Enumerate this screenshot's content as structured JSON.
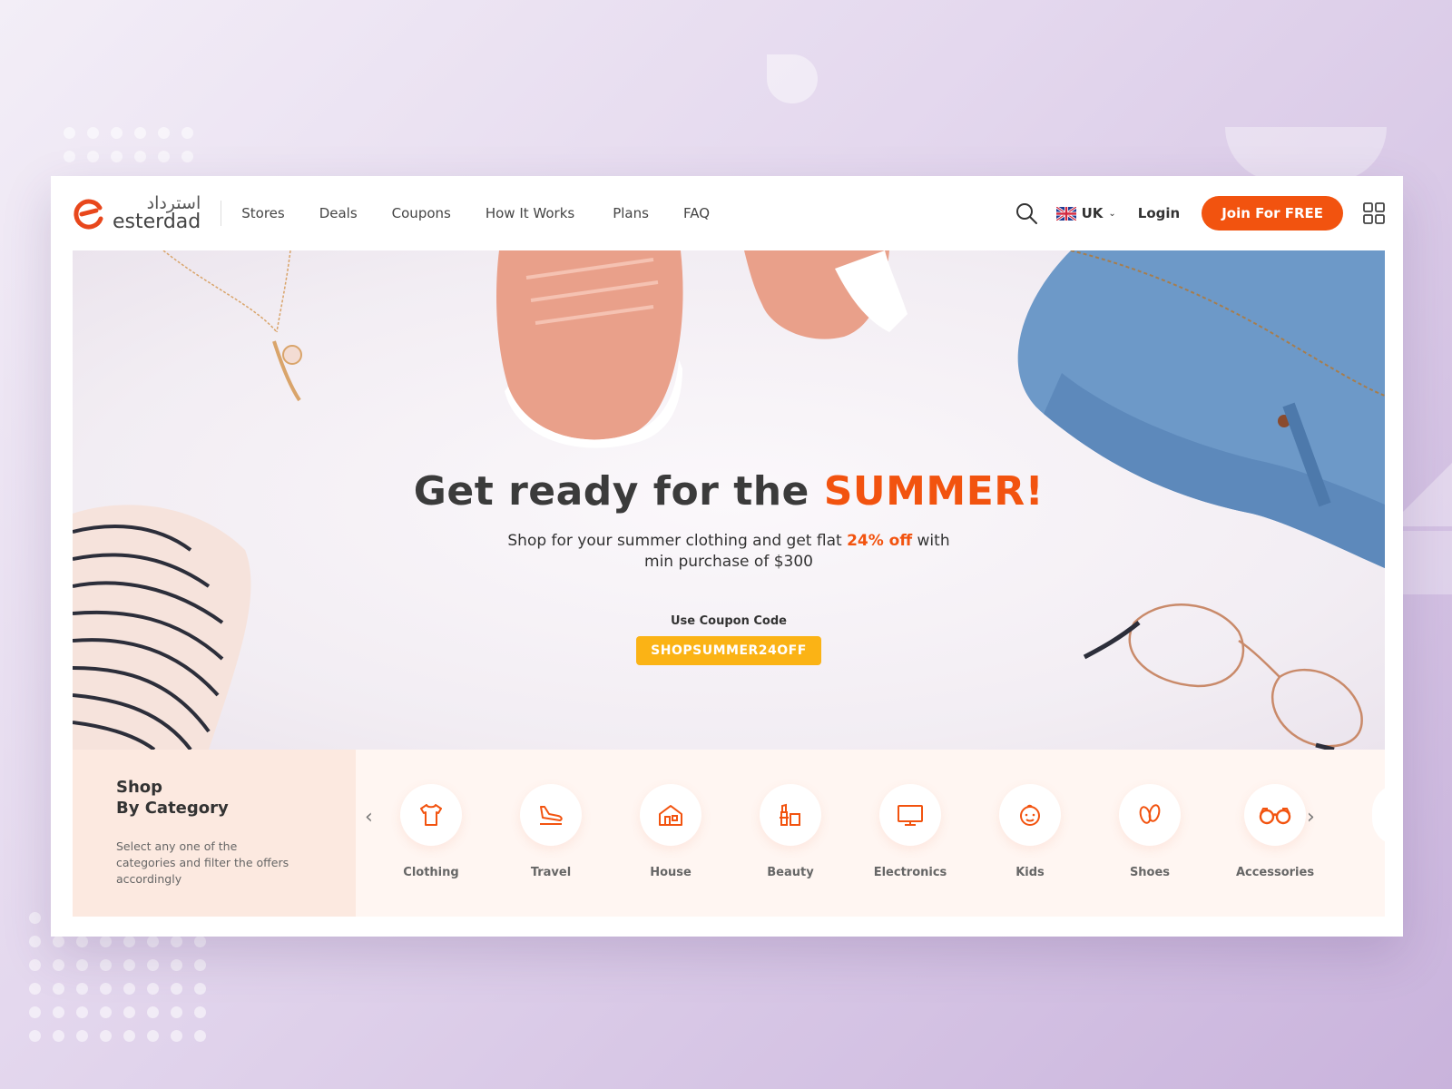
{
  "header": {
    "logo_arabic": "استرداد",
    "logo_text": "esterdad",
    "nav": [
      "Stores",
      "Deals",
      "Coupons",
      "How It Works",
      "Plans",
      "FAQ"
    ],
    "language": "UK",
    "login_label": "Login",
    "join_label": "Join For FREE"
  },
  "hero": {
    "title_main": "Get ready for the ",
    "title_accent": "SUMMER!",
    "subtitle_pre": "Shop for your summer clothing and get flat ",
    "subtitle_accent": "24% off",
    "subtitle_post": " with",
    "subtitle_line2": "min purchase of $300",
    "coupon_label": "Use Coupon Code",
    "coupon_code": "SHOPSUMMER24OFF"
  },
  "categories": {
    "title_line1": "Shop",
    "title_line2": "By Category",
    "description": "Select any one of the categories and filter the offers accordingly",
    "items": [
      {
        "label": "Clothing",
        "icon": "shirt-icon"
      },
      {
        "label": "Travel",
        "icon": "plane-landing-icon"
      },
      {
        "label": "House",
        "icon": "house-icon"
      },
      {
        "label": "Beauty",
        "icon": "cosmetics-icon"
      },
      {
        "label": "Electronics",
        "icon": "monitor-icon"
      },
      {
        "label": "Kids",
        "icon": "baby-face-icon"
      },
      {
        "label": "Shoes",
        "icon": "footprints-icon"
      },
      {
        "label": "Accessories",
        "icon": "glasses-icon"
      }
    ]
  },
  "colors": {
    "accent": "#f2530f",
    "coupon": "#fbb315"
  }
}
